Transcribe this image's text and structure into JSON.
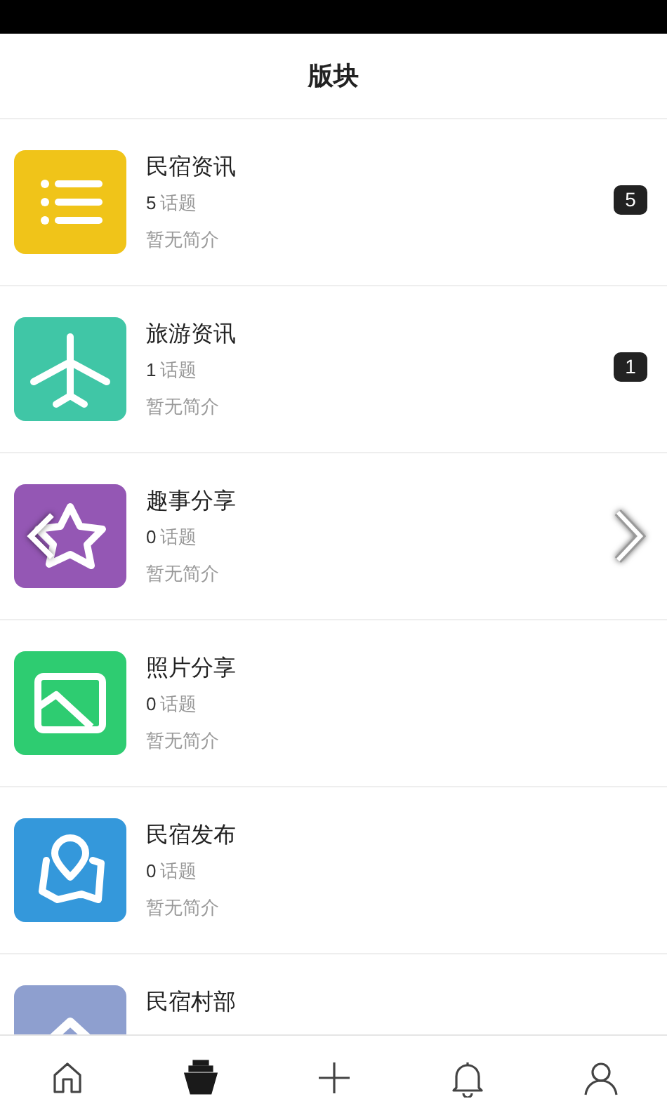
{
  "header": {
    "title": "版块"
  },
  "boards": [
    {
      "kind": "list",
      "color": "#f0c419",
      "title": "民宿资讯",
      "count": "5",
      "count_unit": "话题",
      "description": "暂无简介",
      "badge": "5"
    },
    {
      "kind": "plane",
      "color": "#40c6a6",
      "title": "旅游资讯",
      "count": "1",
      "count_unit": "话题",
      "description": "暂无简介",
      "badge": "1"
    },
    {
      "kind": "star",
      "color": "#9457b4",
      "title": "趣事分享",
      "count": "0",
      "count_unit": "话题",
      "description": "暂无简介"
    },
    {
      "kind": "image",
      "color": "#2ecc71",
      "title": "照片分享",
      "count": "0",
      "count_unit": "话题",
      "description": "暂无简介"
    },
    {
      "kind": "map",
      "color": "#3498db",
      "title": "民宿发布",
      "count": "0",
      "count_unit": "话题",
      "description": "暂无简介"
    },
    {
      "kind": "house",
      "color": "#8e9fcf",
      "title": "民宿村部"
    }
  ],
  "tab_bar": [
    {
      "kind": "home",
      "selected": false
    },
    {
      "kind": "boards",
      "selected": true
    },
    {
      "kind": "add",
      "selected": false
    },
    {
      "kind": "bell",
      "selected": false
    },
    {
      "kind": "profile",
      "selected": false
    }
  ]
}
